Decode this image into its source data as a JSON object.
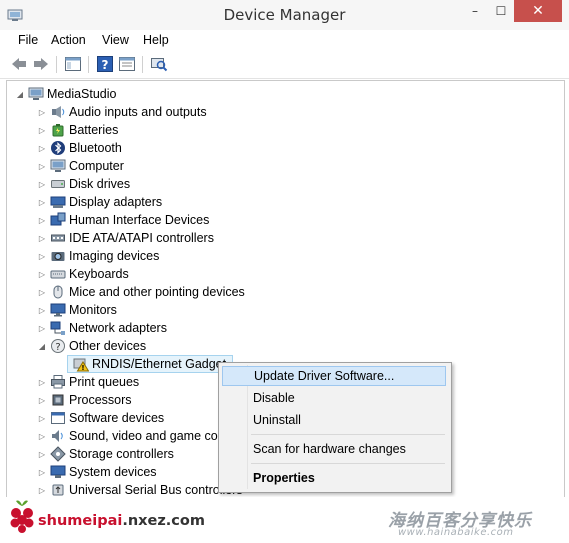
{
  "window": {
    "title": "Device Manager",
    "minimize": "–",
    "maximize": "☐",
    "close": "✕"
  },
  "menu": [
    "File",
    "Action",
    "View",
    "Help"
  ],
  "toolbar": {
    "buttons": [
      "back-icon",
      "forward-icon",
      "show-hide-console-tree-icon",
      "help-icon",
      "properties-icon",
      "scan-hardware-icon"
    ]
  },
  "tree": {
    "root": "MediaStudio",
    "categories": [
      {
        "label": "Audio inputs and outputs",
        "icon": "speaker-icon"
      },
      {
        "label": "Batteries",
        "icon": "battery-icon"
      },
      {
        "label": "Bluetooth",
        "icon": "bluetooth-icon"
      },
      {
        "label": "Computer",
        "icon": "computer-icon"
      },
      {
        "label": "Disk drives",
        "icon": "disk-drive-icon"
      },
      {
        "label": "Display adapters",
        "icon": "display-adapter-icon"
      },
      {
        "label": "Human Interface Devices",
        "icon": "hid-icon"
      },
      {
        "label": "IDE ATA/ATAPI controllers",
        "icon": "ide-controller-icon"
      },
      {
        "label": "Imaging devices",
        "icon": "camera-icon"
      },
      {
        "label": "Keyboards",
        "icon": "keyboard-icon"
      },
      {
        "label": "Mice and other pointing devices",
        "icon": "mouse-icon"
      },
      {
        "label": "Monitors",
        "icon": "monitor-icon"
      },
      {
        "label": "Network adapters",
        "icon": "network-adapter-icon"
      },
      {
        "label": "Other devices",
        "icon": "unknown-device-icon",
        "expanded": true
      },
      {
        "label": "RNDIS/Ethernet Gadget",
        "icon": "warning-device-icon",
        "child": true,
        "selected": true
      },
      {
        "label": "Print queues",
        "icon": "printer-icon"
      },
      {
        "label": "Processors",
        "icon": "processor-icon"
      },
      {
        "label": "Software devices",
        "icon": "software-device-icon"
      },
      {
        "label": "Sound, video and game con",
        "icon": "sound-icon"
      },
      {
        "label": "Storage controllers",
        "icon": "storage-controller-icon"
      },
      {
        "label": "System devices",
        "icon": "system-device-icon"
      },
      {
        "label": "Universal Serial Bus controllers",
        "icon": "usb-icon"
      }
    ]
  },
  "context_menu": {
    "items": [
      "Update Driver Software...",
      "Disable",
      "Uninstall",
      "Scan for hardware changes",
      "Properties"
    ]
  },
  "footer": {
    "site_prefix": "shumeipai",
    "site_suffix": ".nxez.com",
    "watermark_text": "海纳百客分享快乐",
    "watermark_url": "www.hainabaike.com"
  },
  "colors": {
    "close_button": "#c7504c",
    "selection_fill": "#e5f3fb",
    "selection_border": "#a6d3ee",
    "menu_highlight": "#d5e8fa",
    "raspberry_red": "#c8102e"
  }
}
